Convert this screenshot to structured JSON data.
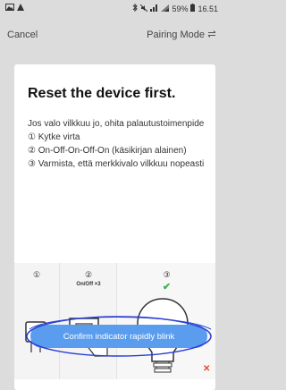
{
  "status_bar": {
    "battery": "59%",
    "time": "16.51",
    "left_icons": [
      "image-icon",
      "navigation-icon"
    ],
    "right_icons": [
      "bluetooth-icon",
      "mute-icon",
      "signal-icon",
      "wifi-icon",
      "battery-icon"
    ]
  },
  "nav": {
    "cancel": "Cancel",
    "mode": "Pairing Mode",
    "mode_icon": "switch-icon"
  },
  "card": {
    "title": "Reset the device first.",
    "instructions": [
      "Jos valo vilkkuu jo, ohita palautustoimenpide",
      "① Kytke virta",
      "② On-Off-On-Off-On (käsikirjan alainen)",
      "③ Varmista, että merkkivalo vilkkuu nopeasti"
    ],
    "steps": [
      {
        "number": "①",
        "caption": "",
        "icon": "power-plug-icon"
      },
      {
        "number": "②",
        "caption": "On/Off ×3",
        "icon": "wall-switch-hand-icon"
      },
      {
        "number": "③",
        "caption": "",
        "icon": "light-bulb-icon",
        "status_icon": "checkmark-icon"
      }
    ]
  },
  "confirm_button": "Confirm indicator rapidly blink",
  "colors": {
    "button": "#5a9dee",
    "check": "#3bb54a",
    "x_mark": "#e84a2c",
    "annotation_circle": "#2a3fd6"
  }
}
